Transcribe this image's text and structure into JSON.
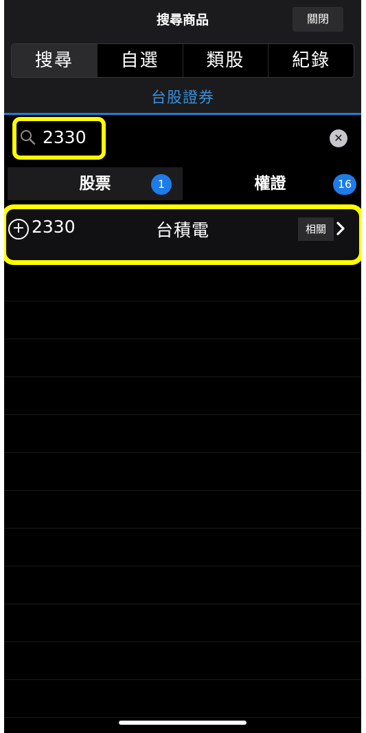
{
  "header": {
    "title": "搜尋商品",
    "close_label": "關閉"
  },
  "tabs": [
    {
      "label": "搜尋",
      "active": true
    },
    {
      "label": "自選",
      "active": false
    },
    {
      "label": "類股",
      "active": false
    },
    {
      "label": "紀錄",
      "active": false
    }
  ],
  "market": {
    "label": "台股證券"
  },
  "search": {
    "value": "2330",
    "icon": "search-icon",
    "clear_icon": "clear-icon"
  },
  "categories": [
    {
      "label": "股票",
      "count": "1"
    },
    {
      "label": "權證",
      "count": "16"
    }
  ],
  "results": [
    {
      "code": "2330",
      "name": "台積電",
      "related_label": "相關"
    }
  ],
  "colors": {
    "accent": "#1e7ce8",
    "market_text": "#3a8fdc",
    "highlight": "#ffff00"
  }
}
